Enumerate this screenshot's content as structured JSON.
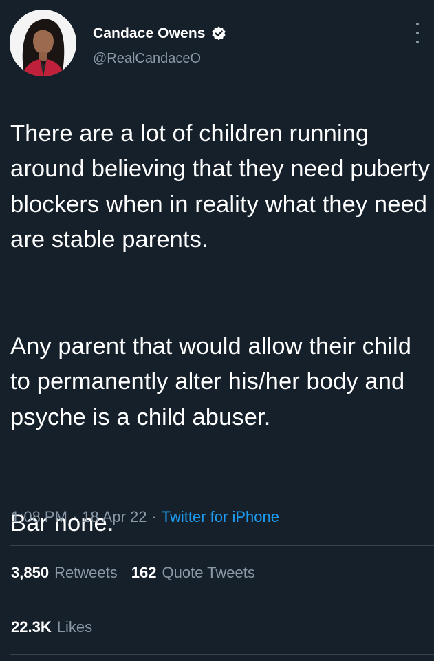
{
  "author": {
    "display_name": "Candace Owens",
    "handle": "@RealCandaceO",
    "verified_icon": "verified-badge-icon"
  },
  "tweet": {
    "paragraphs": [
      "There are a lot of children running around believing that they need puberty blockers when in reality what they need are stable parents.",
      "Any parent that would allow their child to permanently alter his/her body and psyche is a child abuser.",
      "Bar none."
    ],
    "time": "1:08 PM",
    "date": "18 Apr 22",
    "separator": "·",
    "source": "Twitter for iPhone"
  },
  "stats": {
    "retweets_count": "3,850",
    "retweets_label": "Retweets",
    "quotes_count": "162",
    "quotes_label": "Quote Tweets",
    "likes_count": "22.3K",
    "likes_label": "Likes"
  },
  "colors": {
    "background": "#15202b",
    "text": "#ffffff",
    "muted": "#8b98a5",
    "link": "#1d9bf0",
    "divider": "#38444d"
  }
}
